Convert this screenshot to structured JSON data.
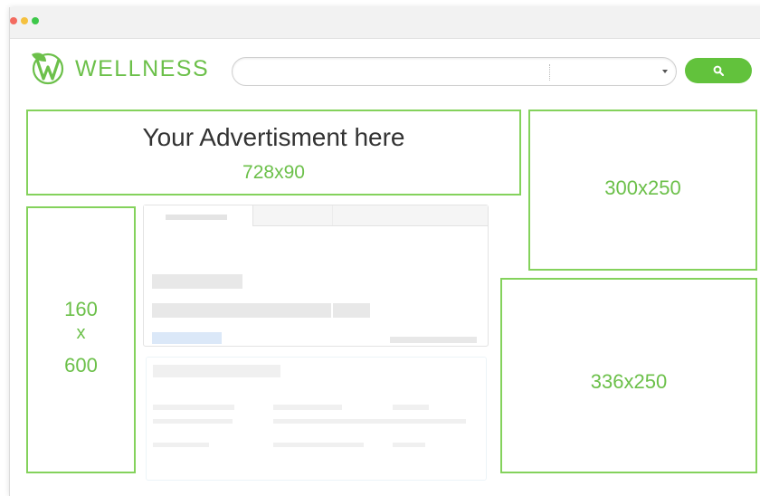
{
  "window": {
    "controls": [
      "close",
      "minimize",
      "maximize"
    ]
  },
  "brand": {
    "logo_letter": "W",
    "name": "WELLNESS",
    "color": "#6cc04a"
  },
  "search": {
    "placeholder": "",
    "value": "",
    "button_icon": "search-icon",
    "button_color": "#62c23c"
  },
  "ads": {
    "leaderboard": {
      "headline": "Your Advertisment here",
      "size": "728x90"
    },
    "medium_rectangle": {
      "size": "300x250"
    },
    "skyscraper": {
      "width": "160",
      "by": "x",
      "height": "600"
    },
    "large_rectangle": {
      "size": "336x250"
    }
  },
  "colors": {
    "ad_border": "#84d25c",
    "ad_text": "#6cc04a",
    "placeholder_blue": "#dbe8f8"
  }
}
